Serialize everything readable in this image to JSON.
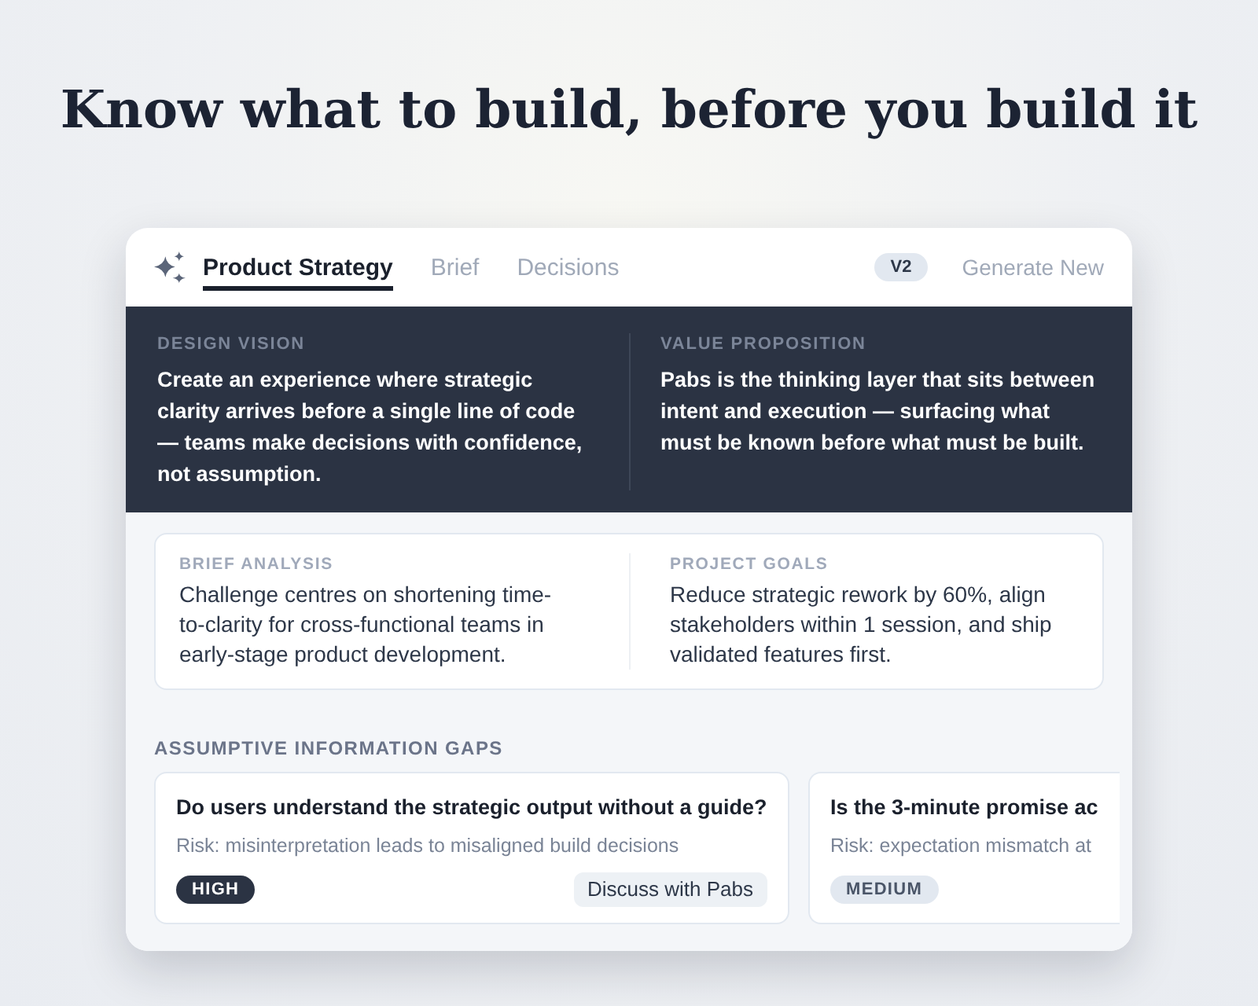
{
  "headline": "Know what to build, before you build it",
  "panel": {
    "tabs": [
      {
        "label": "Product Strategy",
        "selected": true
      },
      {
        "label": "Brief",
        "selected": false
      },
      {
        "label": "Decisions",
        "selected": false
      }
    ],
    "version_badge": "V2",
    "generate_button": "Generate New",
    "highlights": [
      {
        "label": "DESIGN VISION",
        "text": "Create an experience where strategic clarity arrives before a single line of code — teams make decisions with confidence, not assumption."
      },
      {
        "label": "VALUE PROPOSITION",
        "text": "Pabs is the thinking layer that sits between intent and execution — surfacing what must be known before what must be built."
      }
    ],
    "summary": [
      {
        "label": "BRIEF ANALYSIS",
        "text": "Challenge centres on shortening time-to-clarity for cross-functional teams in early-stage product development."
      },
      {
        "label": "PROJECT GOALS",
        "text": "Reduce strategic rework by 60%, align stakeholders within 1 session, and ship validated features first."
      }
    ],
    "gaps_heading": "ASSUMPTIVE INFORMATION GAPS",
    "gaps": [
      {
        "question": "Do users understand the strategic output without a guide?",
        "risk": "Risk: misinterpretation leads to misaligned build decisions",
        "severity": "HIGH",
        "kind": "high",
        "action": "Discuss with Pabs"
      },
      {
        "question": "Is the 3-minute promise ac",
        "risk": "Risk: expectation mismatch at",
        "severity": "MEDIUM",
        "kind": "medium"
      }
    ]
  }
}
